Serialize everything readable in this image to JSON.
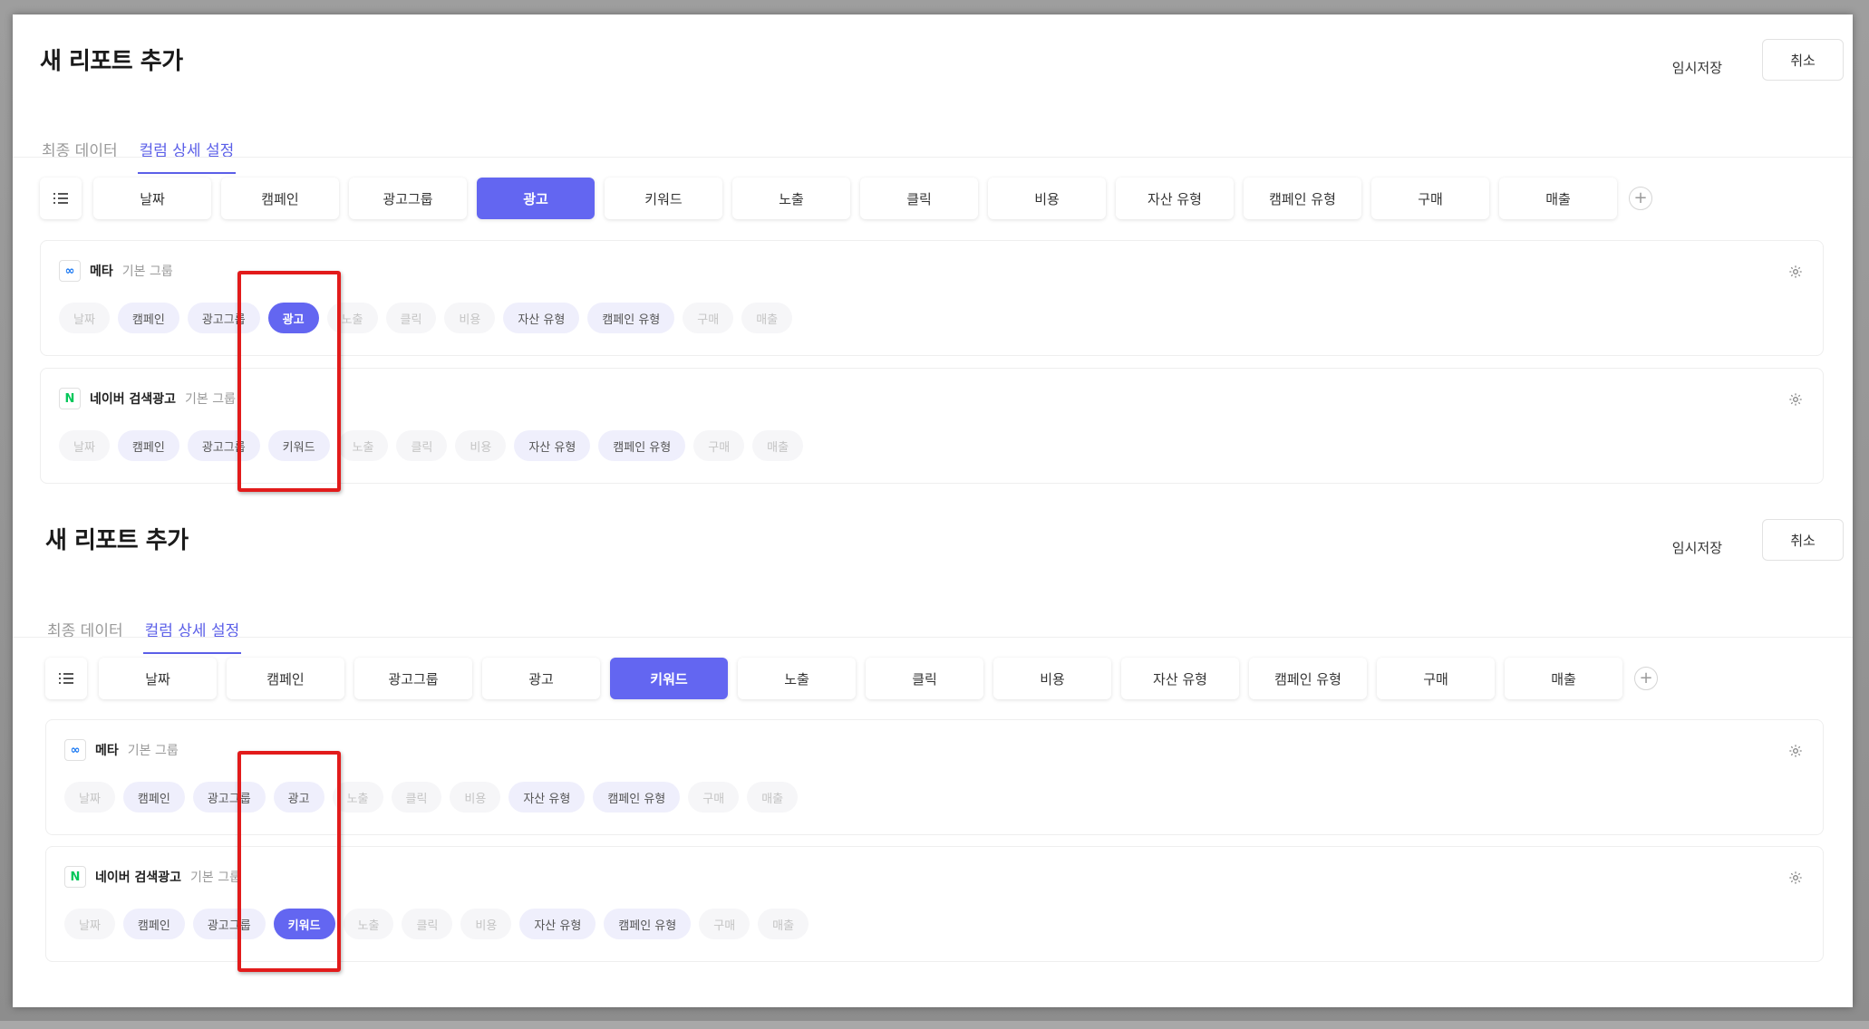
{
  "panels": [
    {
      "title": "새 리포트 추가",
      "buttons": {
        "temp_save": "임시저장",
        "cancel": "취소"
      },
      "tabs": [
        {
          "label": "최종 데이터",
          "active": false
        },
        {
          "label": "컬럼 상세 설정",
          "active": true
        }
      ],
      "columns": [
        "날짜",
        "캠페인",
        "광고그룹",
        "광고",
        "키워드",
        "노출",
        "클릭",
        "비용",
        "자산 유형",
        "캠페인 유형",
        "구매",
        "매출"
      ],
      "selected_column": "광고",
      "sources": [
        {
          "name": "메타",
          "group": "기본 그룹",
          "logo": "meta-logo",
          "chips": [
            "날짜",
            "캠페인",
            "광고그룹",
            "광고",
            "노출",
            "클릭",
            "비용",
            "자산 유형",
            "캠페인 유형",
            "구매",
            "매출"
          ]
        },
        {
          "name": "네이버 검색광고",
          "group": "기본 그룹",
          "logo": "naver-logo",
          "chips": [
            "날짜",
            "캠페인",
            "광고그룹",
            "키워드",
            "노출",
            "클릭",
            "비용",
            "자산 유형",
            "캠페인 유형",
            "구매",
            "매출"
          ]
        }
      ]
    },
    {
      "title": "새 리포트 추가",
      "buttons": {
        "temp_save": "임시저장",
        "cancel": "취소"
      },
      "tabs": [
        {
          "label": "최종 데이터",
          "active": false
        },
        {
          "label": "컬럼 상세 설정",
          "active": true
        }
      ],
      "columns": [
        "날짜",
        "캠페인",
        "광고그룹",
        "광고",
        "키워드",
        "노출",
        "클릭",
        "비용",
        "자산 유형",
        "캠페인 유형",
        "구매",
        "매출"
      ],
      "selected_column": "키워드",
      "sources": [
        {
          "name": "메타",
          "group": "기본 그룹",
          "logo": "meta-logo",
          "chips": [
            "날짜",
            "캠페인",
            "광고그룹",
            "광고",
            "노출",
            "클릭",
            "비용",
            "자산 유형",
            "캠페인 유형",
            "구매",
            "매출"
          ]
        },
        {
          "name": "네이버 검색광고",
          "group": "기본 그룹",
          "logo": "naver-logo",
          "chips": [
            "날짜",
            "캠페인",
            "광고그룹",
            "키워드",
            "노출",
            "클릭",
            "비용",
            "자산 유형",
            "캠페인 유형",
            "구매",
            "매출"
          ]
        }
      ]
    }
  ],
  "colors": {
    "accent": "#6366f1",
    "annotation": "#e21b1b",
    "meta": "#1877f2",
    "naver": "#03c75a"
  }
}
